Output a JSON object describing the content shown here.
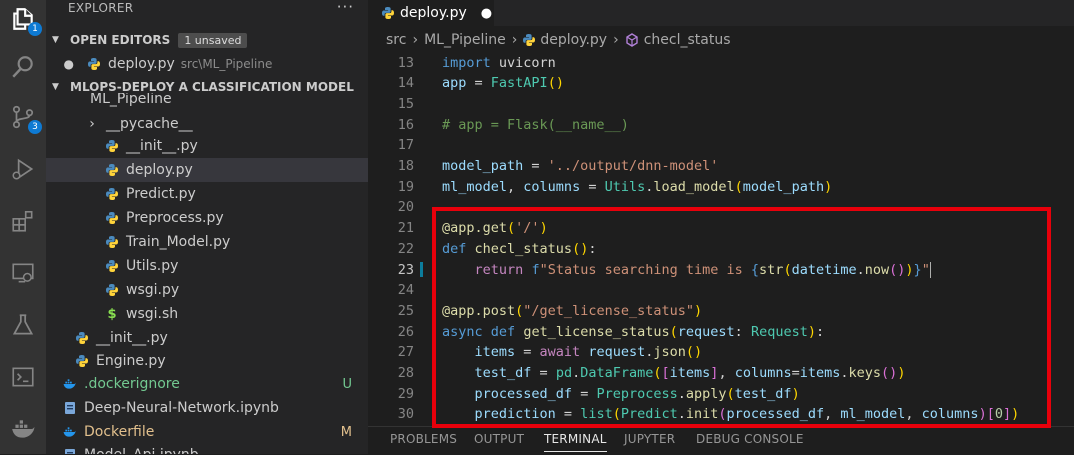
{
  "activity_bar": {
    "explorer_badge": "1",
    "source_control_badge": "3"
  },
  "sidebar": {
    "title": "EXPLORER",
    "more": "···",
    "open_editors": {
      "label": "OPEN EDITORS",
      "badge": "1 unsaved"
    },
    "open_files": [
      {
        "name": "deploy.py",
        "path": "src\\ML_Pipeline"
      }
    ],
    "project": {
      "label": "MLOPS-DEPLOY A CLASSIFICATION MODEL"
    },
    "tree": [
      {
        "label": "ML_Pipeline",
        "partial": true
      },
      {
        "label": "__pycache__",
        "type": "folder"
      },
      {
        "label": "__init__.py",
        "type": "py"
      },
      {
        "label": "deploy.py",
        "type": "py",
        "selected": true
      },
      {
        "label": "Predict.py",
        "type": "py"
      },
      {
        "label": "Preprocess.py",
        "type": "py"
      },
      {
        "label": "Train_Model.py",
        "type": "py"
      },
      {
        "label": "Utils.py",
        "type": "py"
      },
      {
        "label": "wsgi.py",
        "type": "py"
      },
      {
        "label": "wsgi.sh",
        "type": "sh"
      },
      {
        "label": "__init__.py",
        "type": "py"
      },
      {
        "label": "Engine.py",
        "type": "py"
      },
      {
        "label": ".dockerignore",
        "type": "docker",
        "status": "U"
      },
      {
        "label": "Deep-Neural-Network.ipynb",
        "type": "nb"
      },
      {
        "label": "Dockerfile",
        "type": "docker",
        "status": "M"
      },
      {
        "label": "Model_Api.ipynb",
        "type": "nb"
      }
    ]
  },
  "editor": {
    "tab": {
      "label": "deploy.py",
      "dirty_indicator": "●"
    },
    "breadcrumb": [
      "src",
      "ML_Pipeline",
      "deploy.py",
      "checl_status"
    ],
    "lines": [
      {
        "n": "13",
        "tokens": [
          [
            "kw",
            "import"
          ],
          [
            "op",
            " uvicorn"
          ]
        ]
      },
      {
        "n": "14",
        "tokens": [
          [
            "var",
            "app"
          ],
          [
            "op",
            " = "
          ],
          [
            "cls",
            "FastAPI"
          ],
          [
            "br1",
            "()"
          ]
        ]
      },
      {
        "n": "15",
        "tokens": []
      },
      {
        "n": "16",
        "tokens": [
          [
            "cm",
            "# app = Flask(__name__)"
          ]
        ]
      },
      {
        "n": "17",
        "tokens": []
      },
      {
        "n": "18",
        "tokens": [
          [
            "var",
            "model_path"
          ],
          [
            "op",
            " = "
          ],
          [
            "str",
            "'../output/dnn-model'"
          ]
        ]
      },
      {
        "n": "19",
        "tokens": [
          [
            "var",
            "ml_model"
          ],
          [
            "op",
            ", "
          ],
          [
            "var",
            "columns"
          ],
          [
            "op",
            " = "
          ],
          [
            "cls",
            "Utils"
          ],
          [
            "op",
            "."
          ],
          [
            "fn",
            "load_model"
          ],
          [
            "br1",
            "("
          ],
          [
            "var",
            "model_path"
          ],
          [
            "br1",
            ")"
          ]
        ]
      },
      {
        "n": "20",
        "tokens": []
      },
      {
        "n": "21",
        "tokens": [
          [
            "fn",
            "@app.get"
          ],
          [
            "br1",
            "("
          ],
          [
            "str",
            "'/'"
          ],
          [
            "br1",
            ")"
          ]
        ]
      },
      {
        "n": "22",
        "tokens": [
          [
            "kw",
            "def"
          ],
          [
            "op",
            " "
          ],
          [
            "fn",
            "checl_status"
          ],
          [
            "br1",
            "()"
          ],
          [
            "op",
            ":"
          ]
        ]
      },
      {
        "n": "23",
        "tokens": [
          [
            "op",
            "    "
          ],
          [
            "ctl",
            "return"
          ],
          [
            "op",
            " "
          ],
          [
            "kw",
            "f"
          ],
          [
            "str",
            "\"Status searching time is "
          ],
          [
            "kw",
            "{"
          ],
          [
            "fn",
            "str"
          ],
          [
            "br1",
            "("
          ],
          [
            "var",
            "datetime"
          ],
          [
            "op",
            "."
          ],
          [
            "fn",
            "now"
          ],
          [
            "br2",
            "()"
          ],
          [
            "br1",
            ")"
          ],
          [
            "kw",
            "}"
          ],
          [
            "str",
            "\""
          ]
        ],
        "cursor": true
      },
      {
        "n": "24",
        "tokens": []
      },
      {
        "n": "25",
        "tokens": [
          [
            "fn",
            "@app.post"
          ],
          [
            "br1",
            "("
          ],
          [
            "str",
            "\"/get_license_status\""
          ],
          [
            "br1",
            ")"
          ]
        ]
      },
      {
        "n": "26",
        "tokens": [
          [
            "kw",
            "async"
          ],
          [
            "op",
            " "
          ],
          [
            "kw",
            "def"
          ],
          [
            "op",
            " "
          ],
          [
            "fn",
            "get_license_status"
          ],
          [
            "br1",
            "("
          ],
          [
            "var",
            "request"
          ],
          [
            "op",
            ": "
          ],
          [
            "cls",
            "Request"
          ],
          [
            "br1",
            ")"
          ],
          [
            "op",
            ":"
          ]
        ]
      },
      {
        "n": "27",
        "tokens": [
          [
            "op",
            "    "
          ],
          [
            "var",
            "items"
          ],
          [
            "op",
            " = "
          ],
          [
            "ctl",
            "await"
          ],
          [
            "op",
            " "
          ],
          [
            "var",
            "request"
          ],
          [
            "op",
            "."
          ],
          [
            "fn",
            "json"
          ],
          [
            "br1",
            "()"
          ]
        ]
      },
      {
        "n": "28",
        "tokens": [
          [
            "op",
            "    "
          ],
          [
            "var",
            "test_df"
          ],
          [
            "op",
            " = "
          ],
          [
            "cls",
            "pd"
          ],
          [
            "op",
            "."
          ],
          [
            "cls",
            "DataFrame"
          ],
          [
            "br1",
            "("
          ],
          [
            "br2",
            "["
          ],
          [
            "var",
            "items"
          ],
          [
            "br2",
            "]"
          ],
          [
            "op",
            ", "
          ],
          [
            "var",
            "columns"
          ],
          [
            "op",
            "="
          ],
          [
            "var",
            "items"
          ],
          [
            "op",
            "."
          ],
          [
            "fn",
            "keys"
          ],
          [
            "br2",
            "()"
          ],
          [
            "br1",
            ")"
          ]
        ]
      },
      {
        "n": "29",
        "tokens": [
          [
            "op",
            "    "
          ],
          [
            "var",
            "processed_df"
          ],
          [
            "op",
            " = "
          ],
          [
            "cls",
            "Preprocess"
          ],
          [
            "op",
            "."
          ],
          [
            "fn",
            "apply"
          ],
          [
            "br1",
            "("
          ],
          [
            "var",
            "test_df"
          ],
          [
            "br1",
            ")"
          ]
        ]
      },
      {
        "n": "30",
        "tokens": [
          [
            "op",
            "    "
          ],
          [
            "var",
            "prediction"
          ],
          [
            "op",
            " = "
          ],
          [
            "cls",
            "list"
          ],
          [
            "br1",
            "("
          ],
          [
            "cls",
            "Predict"
          ],
          [
            "op",
            "."
          ],
          [
            "fn",
            "init"
          ],
          [
            "br2",
            "("
          ],
          [
            "var",
            "processed_df"
          ],
          [
            "op",
            ", "
          ],
          [
            "var",
            "ml_model"
          ],
          [
            "op",
            ", "
          ],
          [
            "var",
            "columns"
          ],
          [
            "br2",
            ")"
          ],
          [
            "br2",
            "["
          ],
          [
            "num",
            "0"
          ],
          [
            "br2",
            "]"
          ],
          [
            "br1",
            ")"
          ]
        ]
      }
    ]
  },
  "panel": {
    "tabs": [
      "PROBLEMS",
      "OUTPUT",
      "TERMINAL",
      "JUPYTER",
      "DEBUG CONSOLE"
    ],
    "active": "TERMINAL"
  }
}
